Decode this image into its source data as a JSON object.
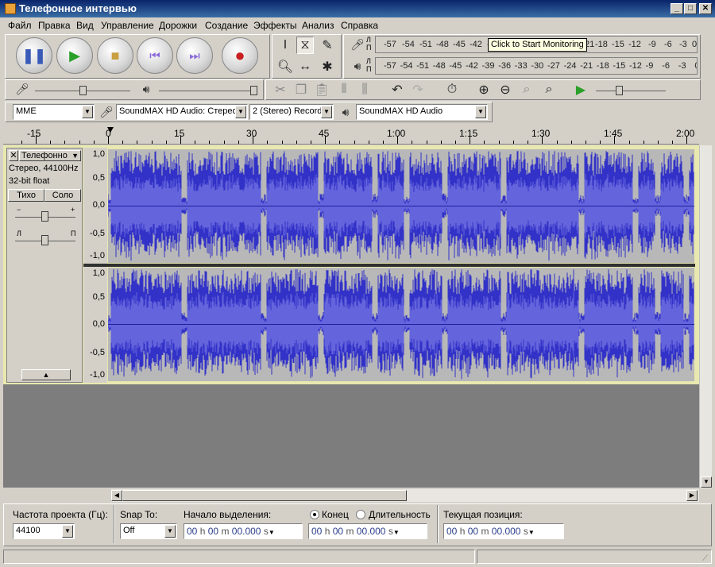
{
  "window": {
    "title": "Телефонное интервью"
  },
  "menu": [
    "Файл",
    "Правка",
    "Вид",
    "Управление",
    "Дорожки",
    "Создание",
    "Эффекты",
    "Анализ",
    "Справка"
  ],
  "meter_scale": {
    "record": [
      "-57",
      "-54",
      "-51",
      "-48",
      "-45",
      "-42",
      "-3"
    ],
    "record_tail": [
      "21",
      "-18",
      "-15",
      "-12",
      "-9",
      "-6",
      "-3",
      "0"
    ],
    "play": [
      "-57",
      "-54",
      "-51",
      "-48",
      "-45",
      "-42",
      "-39",
      "-36",
      "-33",
      "-30",
      "-27",
      "-24",
      "-21",
      "-18",
      "-15",
      "-12",
      "-9",
      "-6",
      "-3",
      "0"
    ],
    "lr": [
      "Л",
      "П"
    ]
  },
  "tooltip": "Click to Start Monitoring",
  "device": {
    "host": "MME",
    "input": "SoundMAX HD Audio: Стерео",
    "channels": "2 (Stereo) Record",
    "output": "SoundMAX HD Audio"
  },
  "ruler": [
    "-15",
    "0",
    "15",
    "30",
    "45",
    "1:00",
    "1:15",
    "1:30",
    "1:45",
    "2:00"
  ],
  "track": {
    "name": "Телефонно",
    "info1": "Стерео, 44100Hz",
    "info2": "32-bit float",
    "mute": "Тихо",
    "solo": "Соло",
    "gain_minus": "−",
    "gain_plus": "+",
    "pan_left": "Л",
    "pan_right": "П",
    "scale": [
      "1,0",
      "0,5",
      "0,0",
      "-0,5",
      "-1,0"
    ]
  },
  "bottom": {
    "rate_label": "Частота проекта (Гц):",
    "rate_value": "44100",
    "snap_label": "Snap To:",
    "snap_value": "Off",
    "sel_start_label": "Начало выделения:",
    "end_label": "Конец",
    "length_label": "Длительность",
    "pos_label": "Текущая позиция:",
    "t1": {
      "h": "00",
      "hl": "h",
      "m": "00",
      "ml": "m",
      "s": "00.000",
      "sl": "s"
    },
    "t2": {
      "h": "00",
      "hl": "h",
      "m": "00",
      "ml": "m",
      "s": "00.000",
      "sl": "s"
    },
    "t3": {
      "h": "00",
      "hl": "h",
      "m": "00",
      "ml": "m",
      "s": "00.000",
      "sl": "s"
    }
  },
  "colors": {
    "wave": "#3232c8",
    "wave_rms": "#6464dc",
    "wave_bg": "#b8b8b8",
    "accent": "#0a246a"
  }
}
